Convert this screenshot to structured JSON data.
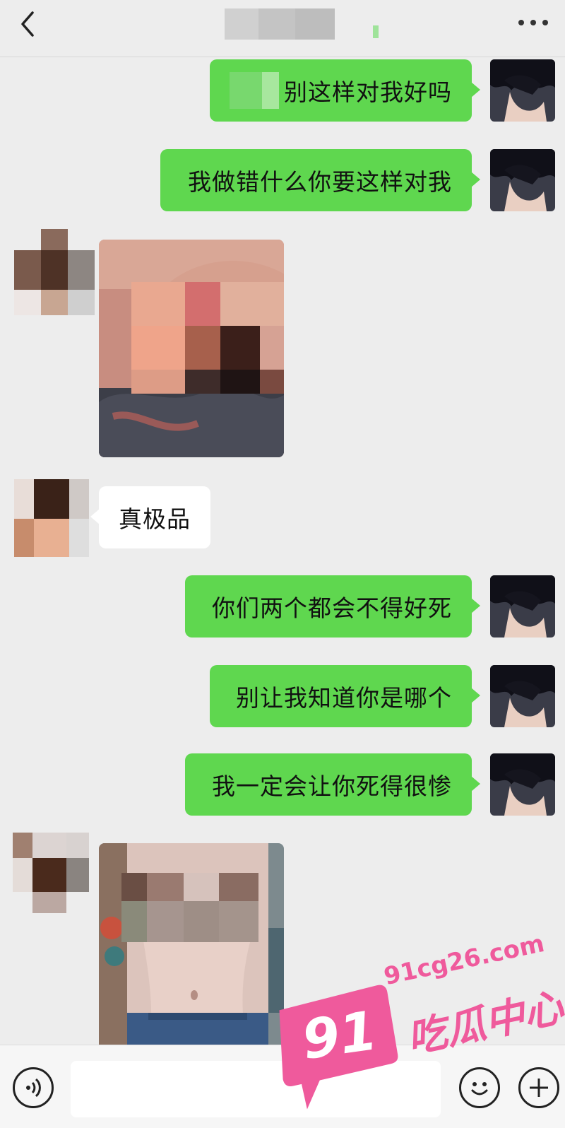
{
  "header": {
    "back_icon": "chevron-left-icon",
    "title_redacted": true,
    "more_icon": "ellipsis-icon"
  },
  "messages": [
    {
      "side": "out",
      "type": "text",
      "text": "别这样对我好吗",
      "prefix_redacted": true
    },
    {
      "side": "out",
      "type": "text",
      "text": "我做错什么你要这样对我"
    },
    {
      "side": "in",
      "type": "image",
      "redacted": true
    },
    {
      "side": "in",
      "type": "text",
      "text": "真极品"
    },
    {
      "side": "out",
      "type": "text",
      "text": "你们两个都会不得好死"
    },
    {
      "side": "out",
      "type": "text",
      "text": "别让我知道你是哪个"
    },
    {
      "side": "out",
      "type": "text",
      "text": "我一定会让你死得很惨"
    },
    {
      "side": "in",
      "type": "image",
      "redacted": true
    }
  ],
  "input_bar": {
    "voice_icon": "voice-icon",
    "input_value": "",
    "emoji_icon": "emoji-icon",
    "plus_icon": "plus-icon"
  },
  "watermark": {
    "number": "91",
    "domain": "91cg26.com",
    "brand": "吃瓜中心"
  },
  "colors": {
    "background": "#ededed",
    "bubble_out": "#5fd74f",
    "bubble_in": "#ffffff",
    "watermark_pink": "#ef5a9c"
  }
}
